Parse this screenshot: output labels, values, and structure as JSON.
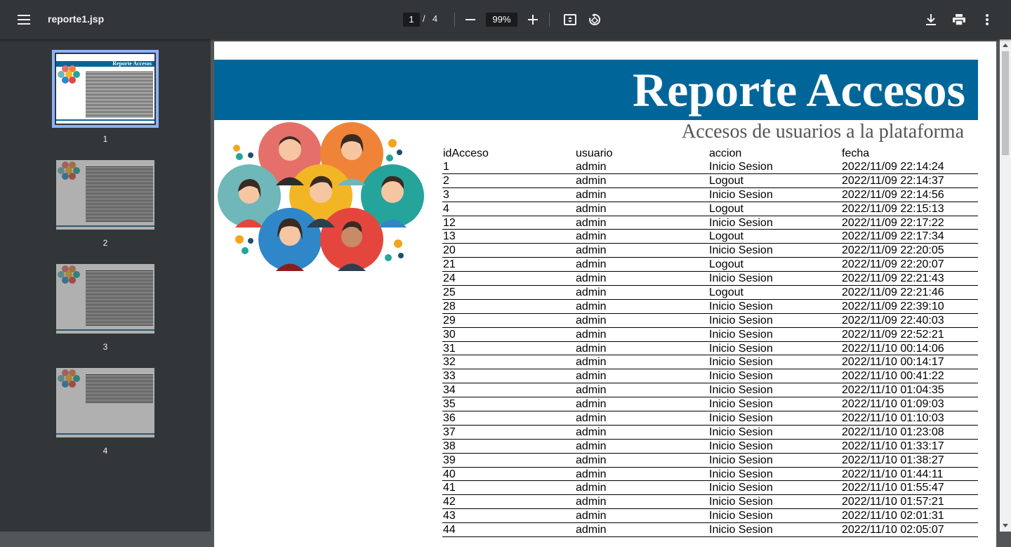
{
  "toolbar": {
    "menu_icon": "hamburger-menu-icon",
    "file_name": "reporte1.jsp",
    "current_page": "1",
    "page_separator": "/",
    "total_pages": "4",
    "zoom": "99%",
    "icons": [
      "zoom-out-icon",
      "zoom-in-icon",
      "fit-page-icon",
      "rotate-icon",
      "download-icon",
      "print-icon",
      "more-vert-icon"
    ]
  },
  "sidebar": {
    "thumbnails": [
      {
        "label": "1"
      },
      {
        "label": "2"
      },
      {
        "label": "3"
      },
      {
        "label": "4"
      }
    ]
  },
  "report": {
    "title": "Reporte Accesos",
    "subtitle": "Accesos de usuarios a la plataforma",
    "thumb_title": "Reporte Accesos",
    "columns": [
      "idAcceso",
      "usuario",
      "accion",
      "fecha"
    ],
    "rows": [
      [
        "1",
        "admin",
        "Inicio Sesion",
        "2022/11/09 22:14:24"
      ],
      [
        "2",
        "admin",
        "Logout",
        "2022/11/09 22:14:37"
      ],
      [
        "3",
        "admin",
        "Inicio Sesion",
        "2022/11/09 22:14:56"
      ],
      [
        "4",
        "admin",
        "Logout",
        "2022/11/09 22:15:13"
      ],
      [
        "12",
        "admin",
        "Inicio Sesion",
        "2022/11/09 22:17:22"
      ],
      [
        "13",
        "admin",
        "Logout",
        "2022/11/09 22:17:34"
      ],
      [
        "20",
        "admin",
        "Inicio Sesion",
        "2022/11/09 22:20:05"
      ],
      [
        "21",
        "admin",
        "Logout",
        "2022/11/09 22:20:07"
      ],
      [
        "24",
        "admin",
        "Inicio Sesion",
        "2022/11/09 22:21:43"
      ],
      [
        "25",
        "admin",
        "Logout",
        "2022/11/09 22:21:46"
      ],
      [
        "28",
        "admin",
        "Inicio Sesion",
        "2022/11/09 22:39:10"
      ],
      [
        "29",
        "admin",
        "Inicio Sesion",
        "2022/11/09 22:40:03"
      ],
      [
        "30",
        "admin",
        "Inicio Sesion",
        "2022/11/09 22:52:21"
      ],
      [
        "31",
        "admin",
        "Inicio Sesion",
        "2022/11/10 00:14:06"
      ],
      [
        "32",
        "admin",
        "Inicio Sesion",
        "2022/11/10 00:14:17"
      ],
      [
        "33",
        "admin",
        "Inicio Sesion",
        "2022/11/10 00:41:22"
      ],
      [
        "34",
        "admin",
        "Inicio Sesion",
        "2022/11/10 01:04:35"
      ],
      [
        "35",
        "admin",
        "Inicio Sesion",
        "2022/11/10 01:09:03"
      ],
      [
        "36",
        "admin",
        "Inicio Sesion",
        "2022/11/10 01:10:03"
      ],
      [
        "37",
        "admin",
        "Inicio Sesion",
        "2022/11/10 01:23:08"
      ],
      [
        "38",
        "admin",
        "Inicio Sesion",
        "2022/11/10 01:33:17"
      ],
      [
        "39",
        "admin",
        "Inicio Sesion",
        "2022/11/10 01:38:27"
      ],
      [
        "40",
        "admin",
        "Inicio Sesion",
        "2022/11/10 01:44:11"
      ],
      [
        "41",
        "admin",
        "Inicio Sesion",
        "2022/11/10 01:55:47"
      ],
      [
        "42",
        "admin",
        "Inicio Sesion",
        "2022/11/10 01:57:21"
      ],
      [
        "43",
        "admin",
        "Inicio Sesion",
        "2022/11/10 02:01:31"
      ],
      [
        "44",
        "admin",
        "Inicio Sesion",
        "2022/11/10 02:05:07"
      ]
    ]
  },
  "colors": {
    "toolbar_bg": "#323639",
    "viewer_bg": "#525659",
    "banner": "#006699",
    "thumb_highlight": "#8ab4f8"
  }
}
